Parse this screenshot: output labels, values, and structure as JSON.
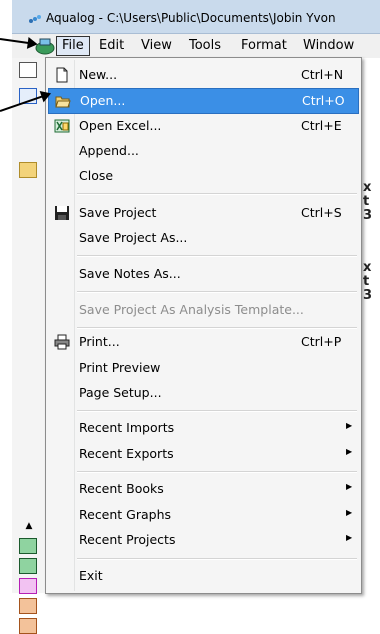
{
  "window": {
    "title": "Aqualog - C:\\Users\\Public\\Documents\\Jobin Yvon"
  },
  "menubar": [
    {
      "label": "File",
      "active": true
    },
    {
      "label": "Edit"
    },
    {
      "label": "View"
    },
    {
      "label": "Tools"
    },
    {
      "label": "Format"
    },
    {
      "label": "Window"
    }
  ],
  "file_menu": {
    "new": {
      "label": "New...",
      "shortcut": "Ctrl+N",
      "icon": "new-document-icon"
    },
    "open": {
      "label": "Open...",
      "shortcut": "Ctrl+O",
      "icon": "open-folder-icon",
      "highlighted": true
    },
    "open_excel": {
      "label": "Open Excel...",
      "shortcut": "Ctrl+E",
      "icon": "excel-icon"
    },
    "append": {
      "label": "Append..."
    },
    "close": {
      "label": "Close"
    },
    "save_project": {
      "label": "Save Project",
      "shortcut": "Ctrl+S",
      "icon": "floppy-disk-icon"
    },
    "save_project_as": {
      "label": "Save Project As..."
    },
    "save_notes_as": {
      "label": "Save Notes As..."
    },
    "save_template": {
      "label": "Save Project As Analysis Template...",
      "disabled": true
    },
    "print": {
      "label": "Print...",
      "shortcut": "Ctrl+P",
      "icon": "printer-icon"
    },
    "print_preview": {
      "label": "Print Preview"
    },
    "page_setup": {
      "label": "Page Setup..."
    },
    "recent_imports": {
      "label": "Recent Imports"
    },
    "recent_exports": {
      "label": "Recent Exports"
    },
    "recent_books": {
      "label": "Recent Books"
    },
    "recent_graphs": {
      "label": "Recent Graphs"
    },
    "recent_projects": {
      "label": "Recent Projects"
    },
    "exit": {
      "label": "Exit"
    }
  },
  "right_strip": [
    "x",
    "t",
    "3",
    "x",
    "t",
    "3"
  ],
  "colors": {
    "highlight": "#3b8fe6",
    "menu_bg": "#f5f5f5",
    "titlebar": "#c9daec"
  }
}
